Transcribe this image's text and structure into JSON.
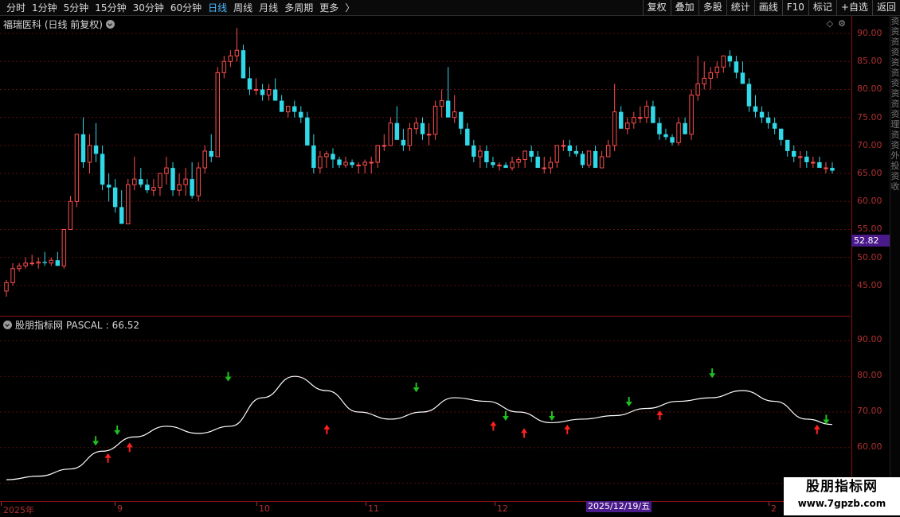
{
  "toolbar": {
    "periods": [
      {
        "label": "分时",
        "active": false
      },
      {
        "label": "1分钟",
        "active": false
      },
      {
        "label": "5分钟",
        "active": false
      },
      {
        "label": "15分钟",
        "active": false
      },
      {
        "label": "30分钟",
        "active": false
      },
      {
        "label": "60分钟",
        "active": false
      },
      {
        "label": "日线",
        "active": true
      },
      {
        "label": "周线",
        "active": false
      },
      {
        "label": "月线",
        "active": false
      },
      {
        "label": "多周期",
        "active": false
      },
      {
        "label": "更多",
        "active": false
      }
    ],
    "more_glyph": "〉",
    "buttons": [
      "复权",
      "叠加",
      "多股",
      "统计",
      "画线",
      "F10",
      "标记",
      "+自选",
      "返回"
    ]
  },
  "main_pane": {
    "title": "福瑞医科 (日线 前复权)",
    "price_tag": "52.82",
    "axis_labels": [
      "90.00",
      "85.00",
      "80.00",
      "75.00",
      "70.00",
      "65.00",
      "60.00",
      "55.00",
      "50.00",
      "45.00"
    ]
  },
  "indicator_pane": {
    "title": "股朋指标网",
    "indicator_name": "PASCAL",
    "indicator_value": "66.52",
    "axis_labels": [
      "90.00",
      "80.00",
      "70.00",
      "60.00",
      "50.00"
    ]
  },
  "date_axis": {
    "labels": [
      "2025年",
      "9",
      "10",
      "11",
      "12",
      "2"
    ],
    "cursor_date": "2025/12/19/五"
  },
  "side_strip": [
    "资",
    "资",
    "资",
    "资",
    "资",
    "资",
    "资",
    "资",
    "资",
    "资",
    "理",
    "资",
    "资",
    "外",
    "投",
    "资",
    "收"
  ],
  "watermark": {
    "title": "股朋指标网",
    "url": "www.7gpzb.com"
  },
  "colors": {
    "up": "#ff4d4d",
    "down": "#30d8e8",
    "buy_arrow": "#ff2020",
    "sell_arrow": "#20c020",
    "grid": "#5a1010",
    "line": "#ffffff",
    "cursor": "#4a1a8a"
  },
  "chart_data": [
    {
      "type": "candlestick",
      "title": "福瑞医科 (日线 前复权)",
      "ylim": [
        42,
        92
      ],
      "y_ticks": [
        45,
        50,
        55,
        60,
        65,
        70,
        75,
        80,
        85,
        90
      ],
      "grid": true,
      "x": [
        1,
        2,
        3,
        4,
        5,
        6,
        7,
        8,
        9,
        10,
        11,
        12,
        13,
        14,
        15,
        16,
        17,
        18,
        19,
        20,
        21,
        22,
        23,
        24,
        25,
        26,
        27,
        28,
        29,
        30,
        31,
        32,
        33,
        34,
        35,
        36,
        37,
        38,
        39,
        40,
        41,
        42,
        43,
        44,
        45,
        46,
        47,
        48,
        49,
        50,
        51,
        52,
        53,
        54,
        55,
        56,
        57,
        58,
        59,
        60,
        61,
        62,
        63,
        64,
        65,
        66,
        67,
        68,
        69,
        70,
        71,
        72,
        73,
        74,
        75,
        76,
        77,
        78,
        79,
        80,
        81,
        82,
        83,
        84,
        85,
        86,
        87,
        88,
        89,
        90,
        91,
        92,
        93,
        94,
        95,
        96,
        97,
        98,
        99,
        100,
        101,
        102,
        103,
        104,
        105,
        106,
        107,
        108,
        109,
        110,
        111,
        112,
        113,
        114,
        115,
        116,
        117,
        118,
        119,
        120,
        121,
        122,
        123,
        124,
        125,
        126,
        127,
        128,
        129,
        130
      ],
      "ohlc": [
        [
          44,
          46,
          43,
          45.5
        ],
        [
          45.5,
          49,
          45,
          48
        ],
        [
          48,
          49,
          47.5,
          48.5
        ],
        [
          48.5,
          50,
          48,
          49
        ],
        [
          49,
          50.5,
          48.5,
          49
        ],
        [
          49,
          50,
          48,
          49.2
        ],
        [
          49.2,
          51,
          48.5,
          49
        ],
        [
          49,
          50,
          48.5,
          49.5
        ],
        [
          49.5,
          51,
          49,
          48.5
        ],
        [
          48.5,
          53,
          48,
          55
        ],
        [
          55,
          61,
          55,
          60
        ],
        [
          60,
          72,
          59,
          72
        ],
        [
          72,
          75,
          66,
          67
        ],
        [
          67,
          72,
          65,
          70
        ],
        [
          70,
          74,
          67,
          68.5
        ],
        [
          68.5,
          70,
          62,
          63
        ],
        [
          63,
          65,
          60,
          62.5
        ],
        [
          62.5,
          64,
          58,
          59
        ],
        [
          59,
          62,
          56,
          56
        ],
        [
          56,
          64,
          56,
          63
        ],
        [
          63,
          68,
          62,
          64
        ],
        [
          64,
          66,
          62.5,
          63
        ],
        [
          63,
          64,
          61.5,
          62
        ],
        [
          62,
          64,
          61,
          62.5
        ],
        [
          62.5,
          65,
          61,
          65
        ],
        [
          65,
          68,
          63,
          66
        ],
        [
          66,
          67,
          61,
          62
        ],
        [
          62,
          65,
          61,
          63
        ],
        [
          63,
          66,
          61,
          64
        ],
        [
          64,
          67,
          60.5,
          61
        ],
        [
          61,
          67,
          60,
          66
        ],
        [
          66,
          70,
          65,
          69
        ],
        [
          69,
          72,
          67,
          68
        ],
        [
          68,
          84,
          68,
          83
        ],
        [
          83,
          86,
          82,
          85
        ],
        [
          85,
          87,
          84,
          86
        ],
        [
          86,
          91,
          85,
          87
        ],
        [
          87,
          88,
          82,
          82
        ],
        [
          82,
          84,
          79,
          80
        ],
        [
          80,
          82,
          79,
          80
        ],
        [
          80,
          81,
          78,
          79
        ],
        [
          79,
          81,
          78,
          80
        ],
        [
          80,
          82,
          78,
          78
        ],
        [
          78,
          79,
          76,
          76
        ],
        [
          76,
          77,
          75,
          77
        ],
        [
          77,
          78,
          75,
          76
        ],
        [
          76,
          77,
          74,
          75
        ],
        [
          75,
          76,
          70,
          70
        ],
        [
          70,
          72,
          65,
          66
        ],
        [
          66,
          69,
          65,
          68
        ],
        [
          68,
          69,
          66,
          68.5
        ],
        [
          68.5,
          69.5,
          66,
          67.5
        ],
        [
          67.5,
          68,
          66,
          66.5
        ],
        [
          66.5,
          68,
          66,
          67
        ],
        [
          67,
          67.5,
          66,
          66.5
        ],
        [
          66.5,
          67,
          65,
          66.5
        ],
        [
          66.5,
          67.5,
          65,
          67
        ],
        [
          67,
          68,
          65,
          67
        ],
        [
          67,
          70,
          66,
          70
        ],
        [
          70,
          72,
          69,
          70
        ],
        [
          70,
          75,
          70,
          74
        ],
        [
          74,
          77,
          73,
          71
        ],
        [
          71,
          73,
          69,
          70
        ],
        [
          70,
          74,
          69,
          73
        ],
        [
          73,
          75,
          72,
          74
        ],
        [
          74,
          75,
          71,
          72
        ],
        [
          72,
          74,
          70,
          72
        ],
        [
          72,
          78,
          71,
          77
        ],
        [
          77,
          80,
          75,
          78
        ],
        [
          78,
          84,
          75,
          75
        ],
        [
          75,
          79,
          74,
          76
        ],
        [
          76,
          76,
          72,
          73
        ],
        [
          73,
          74,
          70,
          70
        ],
        [
          70,
          71,
          67,
          68
        ],
        [
          68,
          70,
          66,
          69
        ],
        [
          69,
          70,
          66,
          67
        ],
        [
          67,
          68,
          66,
          66.5
        ],
        [
          66.5,
          67,
          65.5,
          66.5
        ],
        [
          66.5,
          67,
          66,
          66
        ],
        [
          66,
          68,
          65.5,
          67
        ],
        [
          67,
          68,
          66,
          67.5
        ],
        [
          67.5,
          69,
          66,
          69
        ],
        [
          69,
          70,
          67,
          68
        ],
        [
          68,
          69,
          66,
          66
        ],
        [
          66,
          68,
          65,
          66
        ],
        [
          66,
          68,
          65,
          67
        ],
        [
          67,
          70,
          66,
          70
        ],
        [
          70,
          71,
          69,
          70
        ],
        [
          70,
          71,
          68,
          69
        ],
        [
          69,
          70,
          68,
          68.5
        ],
        [
          68.5,
          69,
          66,
          66.5
        ],
        [
          66.5,
          69,
          66,
          69
        ],
        [
          69,
          70,
          66,
          66
        ],
        [
          66,
          69,
          66,
          68
        ],
        [
          68,
          71,
          68,
          70
        ],
        [
          70,
          81,
          69,
          76
        ],
        [
          76,
          77,
          73,
          73
        ],
        [
          73,
          75,
          72,
          74
        ],
        [
          74,
          76,
          73,
          75
        ],
        [
          75,
          77,
          74,
          75
        ],
        [
          75,
          78,
          74,
          77
        ],
        [
          77,
          78,
          74,
          74
        ],
        [
          74,
          75,
          71,
          72
        ],
        [
          72,
          73,
          71,
          71.5
        ],
        [
          71.5,
          72,
          70,
          70.5
        ],
        [
          70.5,
          75,
          70,
          74
        ],
        [
          74,
          75,
          72,
          72
        ],
        [
          72,
          80,
          71,
          79
        ],
        [
          79,
          86,
          78,
          81
        ],
        [
          81,
          85,
          80,
          82
        ],
        [
          82,
          84,
          80,
          83
        ],
        [
          83,
          85,
          82,
          84
        ],
        [
          84,
          86,
          83,
          86
        ],
        [
          86,
          87,
          84,
          85
        ],
        [
          85,
          86,
          82,
          83
        ],
        [
          83,
          85,
          81,
          81
        ],
        [
          81,
          82,
          76,
          77
        ],
        [
          77,
          79,
          75,
          76
        ],
        [
          76,
          77,
          74,
          75
        ],
        [
          75,
          76,
          73,
          74
        ],
        [
          74,
          75,
          72,
          73
        ],
        [
          73,
          73,
          70,
          71
        ],
        [
          71,
          71,
          68,
          69
        ],
        [
          69,
          70,
          67,
          68
        ],
        [
          68,
          69,
          66,
          68
        ],
        [
          68,
          69,
          66,
          67
        ],
        [
          67,
          68,
          66,
          67
        ],
        [
          67,
          68,
          66,
          66
        ],
        [
          66,
          67,
          65,
          66
        ],
        [
          66,
          67,
          65,
          65.5
        ]
      ]
    },
    {
      "type": "line",
      "series": [
        {
          "name": "PASCAL",
          "x": [
            1,
            6,
            11,
            16,
            21,
            26,
            31,
            36,
            41,
            46,
            51,
            56,
            61,
            66,
            71,
            76,
            81,
            86,
            91,
            96,
            101,
            106,
            111,
            116,
            121,
            126,
            130
          ],
          "values": [
            51,
            52,
            54,
            59,
            63,
            66,
            64,
            66,
            74,
            80,
            76,
            70,
            68,
            70,
            74,
            73,
            70,
            67,
            68,
            69,
            71,
            73,
            74,
            76,
            73,
            68,
            66.5
          ]
        }
      ],
      "ylim": [
        45,
        95
      ],
      "y_ticks": [
        50,
        60,
        70,
        80,
        90
      ],
      "grid": true,
      "annotations": [
        {
          "kind": "sell",
          "x": 30,
          "value": 61
        },
        {
          "kind": "buy",
          "x": 34,
          "value": 58
        },
        {
          "kind": "sell",
          "x": 37,
          "value": 64
        },
        {
          "kind": "buy",
          "x": 41,
          "value": 61
        },
        {
          "kind": "sell",
          "x": 73,
          "value": 79
        },
        {
          "kind": "buy",
          "x": 105,
          "value": 66
        },
        {
          "kind": "sell",
          "x": 134,
          "value": 76
        },
        {
          "kind": "buy",
          "x": 159,
          "value": 67
        },
        {
          "kind": "sell",
          "x": 163,
          "value": 68
        },
        {
          "kind": "buy",
          "x": 169,
          "value": 65
        },
        {
          "kind": "sell",
          "x": 178,
          "value": 68
        },
        {
          "kind": "buy",
          "x": 183,
          "value": 66
        },
        {
          "kind": "sell",
          "x": 203,
          "value": 72
        },
        {
          "kind": "buy",
          "x": 213,
          "value": 70
        },
        {
          "kind": "sell",
          "x": 230,
          "value": 80
        },
        {
          "kind": "buy",
          "x": 264,
          "value": 66
        },
        {
          "kind": "sell",
          "x": 267,
          "value": 67
        }
      ]
    }
  ]
}
